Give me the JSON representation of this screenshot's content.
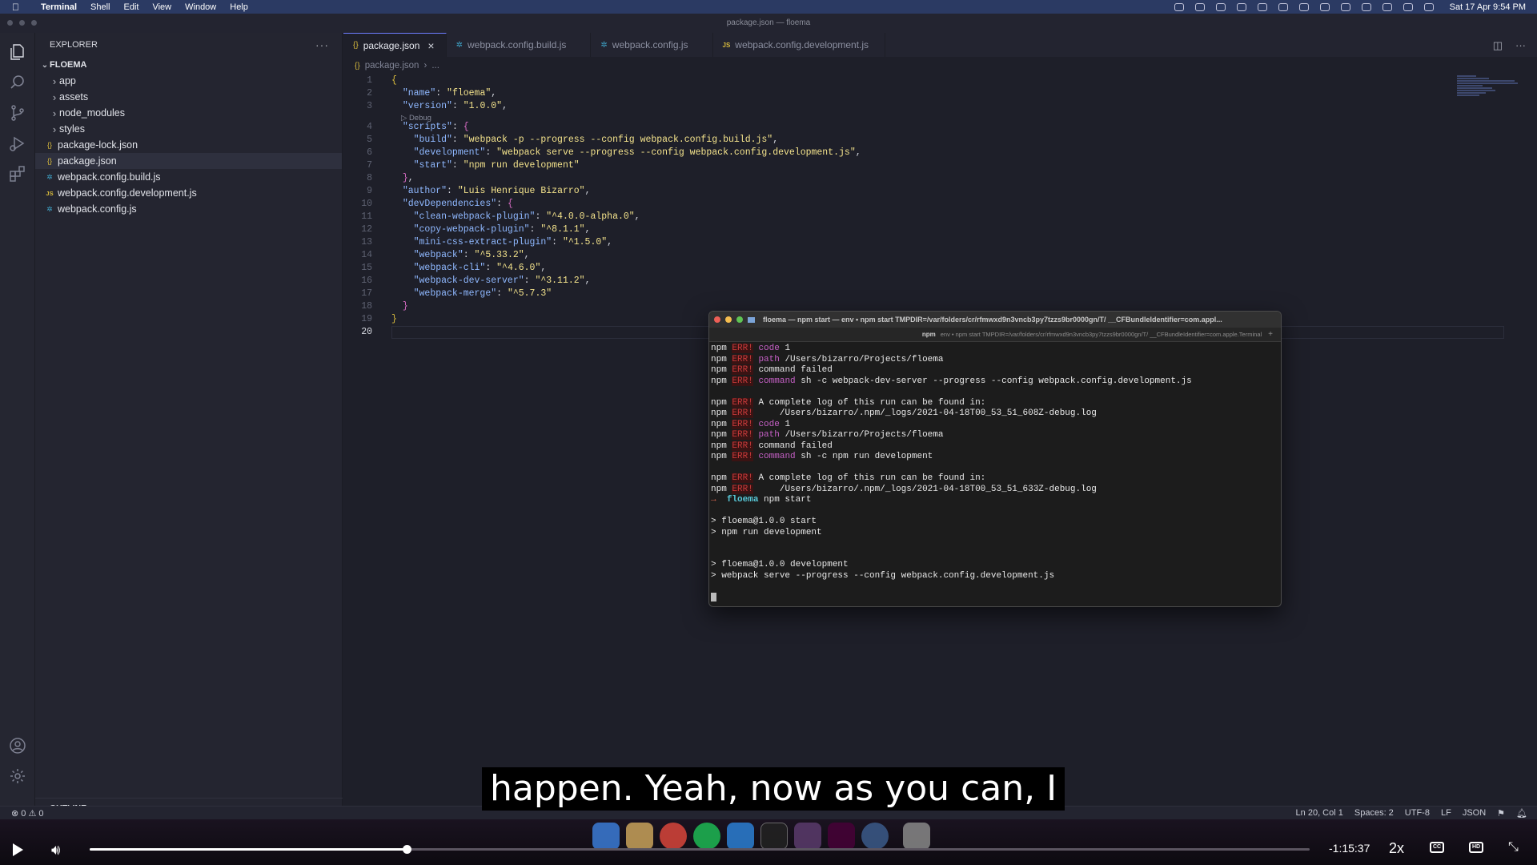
{
  "menubar": {
    "app": "Terminal",
    "items": [
      "Shell",
      "Edit",
      "View",
      "Window",
      "Help"
    ],
    "clock": "Sat 17 Apr  9:54 PM"
  },
  "window_title": "package.json — floema",
  "explorer": {
    "header": "EXPLORER",
    "folder": "FLOEMA",
    "items": [
      {
        "label": "app",
        "type": "folder"
      },
      {
        "label": "assets",
        "type": "folder"
      },
      {
        "label": "node_modules",
        "type": "folder"
      },
      {
        "label": "styles",
        "type": "folder"
      },
      {
        "label": "package-lock.json",
        "type": "json"
      },
      {
        "label": "package.json",
        "type": "json",
        "selected": true
      },
      {
        "label": "webpack.config.build.js",
        "type": "gear"
      },
      {
        "label": "webpack.config.development.js",
        "type": "js"
      },
      {
        "label": "webpack.config.js",
        "type": "gear"
      }
    ],
    "outline": "OUTLINE"
  },
  "tabs": [
    {
      "label": "package.json",
      "icon": "{}",
      "active": true
    },
    {
      "label": "webpack.config.build.js",
      "icon": "gear"
    },
    {
      "label": "webpack.config.js",
      "icon": "gear"
    },
    {
      "label": "webpack.config.development.js",
      "icon": "JS"
    }
  ],
  "breadcrumb": {
    "file": "package.json",
    "more": "..."
  },
  "codelens": "▷ Debug",
  "code": [
    {
      "n": "1",
      "t": "{"
    },
    {
      "n": "2",
      "t": "  \"name\": \"floema\","
    },
    {
      "n": "3",
      "t": "  \"version\": \"1.0.0\","
    },
    {
      "n": "4",
      "t": "  \"scripts\": {"
    },
    {
      "n": "5",
      "t": "    \"build\": \"webpack -p --progress --config webpack.config.build.js\","
    },
    {
      "n": "6",
      "t": "    \"development\": \"webpack serve --progress --config webpack.config.development.js\","
    },
    {
      "n": "7",
      "t": "    \"start\": \"npm run development\""
    },
    {
      "n": "8",
      "t": "  },"
    },
    {
      "n": "9",
      "t": "  \"author\": \"Luis Henrique Bizarro\","
    },
    {
      "n": "10",
      "t": "  \"devDependencies\": {"
    },
    {
      "n": "11",
      "t": "    \"clean-webpack-plugin\": \"^4.0.0-alpha.0\","
    },
    {
      "n": "12",
      "t": "    \"copy-webpack-plugin\": \"^8.1.1\","
    },
    {
      "n": "13",
      "t": "    \"mini-css-extract-plugin\": \"^1.5.0\","
    },
    {
      "n": "14",
      "t": "    \"webpack\": \"^5.33.2\","
    },
    {
      "n": "15",
      "t": "    \"webpack-cli\": \"^4.6.0\","
    },
    {
      "n": "16",
      "t": "    \"webpack-dev-server\": \"^3.11.2\","
    },
    {
      "n": "17",
      "t": "    \"webpack-merge\": \"^5.7.3\""
    },
    {
      "n": "18",
      "t": "  }"
    },
    {
      "n": "19",
      "t": "}"
    },
    {
      "n": "20",
      "t": ""
    }
  ],
  "terminal": {
    "title": "floema — npm start — env • npm start TMPDIR=/var/folders/cr/rfmwxd9n3vncb3py7tzzs9br0000gn/T/ __CFBundleIdentifier=com.appl...",
    "tab_label": "npm",
    "tab_detail": "env • npm start TMPDIR=/var/folders/cr/rfmwxd9n3vncb3py7tzzs9br0000gn/T/ __CFBundleIdentifier=com.apple.Terminal",
    "lines": [
      {
        "k": "err",
        "w": "code",
        "t": " 1"
      },
      {
        "k": "err",
        "w": "path",
        "t": " /Users/bizarro/Projects/floema"
      },
      {
        "k": "err",
        "w": "",
        "t": "command failed"
      },
      {
        "k": "err",
        "w": "command",
        "t": " sh -c webpack-dev-server --progress --config webpack.config.development.js"
      },
      {
        "k": "blank"
      },
      {
        "k": "err",
        "w": "",
        "t": "A complete log of this run can be found in:"
      },
      {
        "k": "err",
        "w": "",
        "t": "    /Users/bizarro/.npm/_logs/2021-04-18T00_53_51_608Z-debug.log"
      },
      {
        "k": "err",
        "w": "code",
        "t": " 1"
      },
      {
        "k": "err",
        "w": "path",
        "t": " /Users/bizarro/Projects/floema"
      },
      {
        "k": "err",
        "w": "",
        "t": "command failed"
      },
      {
        "k": "err",
        "w": "command",
        "t": " sh -c npm run development"
      },
      {
        "k": "blank"
      },
      {
        "k": "err",
        "w": "",
        "t": "A complete log of this run can be found in:"
      },
      {
        "k": "err",
        "w": "",
        "t": "    /Users/bizarro/.npm/_logs/2021-04-18T00_53_51_633Z-debug.log"
      },
      {
        "k": "prompt",
        "dir": "floema",
        "t": " npm start"
      },
      {
        "k": "blank"
      },
      {
        "k": "plain",
        "t": "> floema@1.0.0 start"
      },
      {
        "k": "plain",
        "t": "> npm run development"
      },
      {
        "k": "blank"
      },
      {
        "k": "blank"
      },
      {
        "k": "plain",
        "t": "> floema@1.0.0 development"
      },
      {
        "k": "plain",
        "t": "> webpack serve --progress --config webpack.config.development.js"
      },
      {
        "k": "blank"
      },
      {
        "k": "cursor"
      }
    ],
    "npm_label": "npm",
    "err_label": "ERR!",
    "prompt_arrow": "→"
  },
  "statusbar": {
    "problems": "⊗ 0 ⚠ 0",
    "position": "Ln 20, Col 1",
    "spaces": "Spaces: 2",
    "encoding": "UTF-8",
    "eol": "LF",
    "language": "JSON"
  },
  "subtitle": "happen. Yeah, now as you can, I",
  "player": {
    "time_remaining": "-1:15:37",
    "speed": "2x",
    "progress": 0.26,
    "cc_label": "CC",
    "hd_label": "HD"
  },
  "colors": {
    "accent": "#6c7cff",
    "error": "#c63a3a",
    "prompt_dir": "#58c7d6"
  }
}
